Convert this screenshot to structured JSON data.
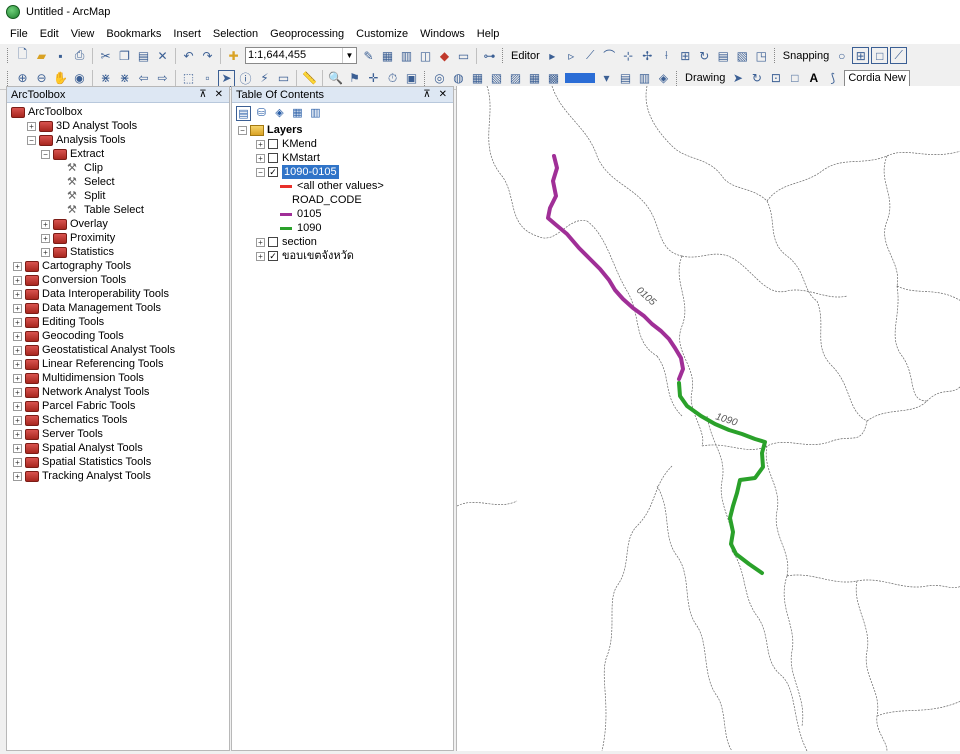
{
  "window": {
    "title": "Untitled - ArcMap"
  },
  "menu": [
    "File",
    "Edit",
    "View",
    "Bookmarks",
    "Insert",
    "Selection",
    "Geoprocessing",
    "Customize",
    "Windows",
    "Help"
  ],
  "toolbar": {
    "scale": "1:1,644,455",
    "editor_label": "Editor",
    "snapping_label": "Snapping",
    "drawing_label": "Drawing",
    "font_name": "Cordia New"
  },
  "toolbox": {
    "title": "ArcToolbox",
    "root": "ArcToolbox",
    "items": [
      {
        "label": "3D Analyst Tools",
        "level": 1,
        "kind": "toolbox",
        "exp": "+"
      },
      {
        "label": "Analysis Tools",
        "level": 1,
        "kind": "toolbox",
        "exp": "-"
      },
      {
        "label": "Extract",
        "level": 2,
        "kind": "toolbox",
        "exp": "-"
      },
      {
        "label": "Clip",
        "level": 3,
        "kind": "tool"
      },
      {
        "label": "Select",
        "level": 3,
        "kind": "tool"
      },
      {
        "label": "Split",
        "level": 3,
        "kind": "tool"
      },
      {
        "label": "Table Select",
        "level": 3,
        "kind": "tool"
      },
      {
        "label": "Overlay",
        "level": 2,
        "kind": "toolbox",
        "exp": "+"
      },
      {
        "label": "Proximity",
        "level": 2,
        "kind": "toolbox",
        "exp": "+"
      },
      {
        "label": "Statistics",
        "level": 2,
        "kind": "toolbox",
        "exp": "+"
      },
      {
        "label": "Cartography Tools",
        "level": 0,
        "kind": "toolbox",
        "exp": "+"
      },
      {
        "label": "Conversion Tools",
        "level": 0,
        "kind": "toolbox",
        "exp": "+"
      },
      {
        "label": "Data Interoperability Tools",
        "level": 0,
        "kind": "toolbox",
        "exp": "+"
      },
      {
        "label": "Data Management Tools",
        "level": 0,
        "kind": "toolbox",
        "exp": "+"
      },
      {
        "label": "Editing Tools",
        "level": 0,
        "kind": "toolbox",
        "exp": "+"
      },
      {
        "label": "Geocoding Tools",
        "level": 0,
        "kind": "toolbox",
        "exp": "+"
      },
      {
        "label": "Geostatistical Analyst Tools",
        "level": 0,
        "kind": "toolbox",
        "exp": "+"
      },
      {
        "label": "Linear Referencing Tools",
        "level": 0,
        "kind": "toolbox",
        "exp": "+"
      },
      {
        "label": "Multidimension Tools",
        "level": 0,
        "kind": "toolbox",
        "exp": "+"
      },
      {
        "label": "Network Analyst Tools",
        "level": 0,
        "kind": "toolbox",
        "exp": "+"
      },
      {
        "label": "Parcel Fabric Tools",
        "level": 0,
        "kind": "toolbox",
        "exp": "+"
      },
      {
        "label": "Schematics Tools",
        "level": 0,
        "kind": "toolbox",
        "exp": "+"
      },
      {
        "label": "Server Tools",
        "level": 0,
        "kind": "toolbox",
        "exp": "+"
      },
      {
        "label": "Spatial Analyst Tools",
        "level": 0,
        "kind": "toolbox",
        "exp": "+"
      },
      {
        "label": "Spatial Statistics Tools",
        "level": 0,
        "kind": "toolbox",
        "exp": "+"
      },
      {
        "label": "Tracking Analyst Tools",
        "level": 0,
        "kind": "toolbox",
        "exp": "+"
      }
    ]
  },
  "toc": {
    "title": "Table Of Contents",
    "root": "Layers",
    "layers": [
      {
        "label": "KMend",
        "checked": false,
        "exp": "+"
      },
      {
        "label": "KMstart",
        "checked": false,
        "exp": "+"
      },
      {
        "label": "1090-0105",
        "checked": true,
        "exp": "-",
        "selected": true,
        "legend": [
          {
            "label": "<all other values>",
            "color": "#e8302a"
          },
          {
            "label": "ROAD_CODE",
            "color": ""
          },
          {
            "label": "0105",
            "color": "#a02f97"
          },
          {
            "label": "1090",
            "color": "#2aa12a"
          }
        ]
      },
      {
        "label": "section",
        "checked": false,
        "exp": "+"
      },
      {
        "label": "ขอบเขตจังหวัด",
        "checked": true,
        "exp": "+"
      }
    ]
  },
  "map": {
    "road_labels": [
      {
        "text": "0105",
        "color": "#a02f97"
      },
      {
        "text": "1090",
        "color": "#2aa12a"
      }
    ]
  }
}
